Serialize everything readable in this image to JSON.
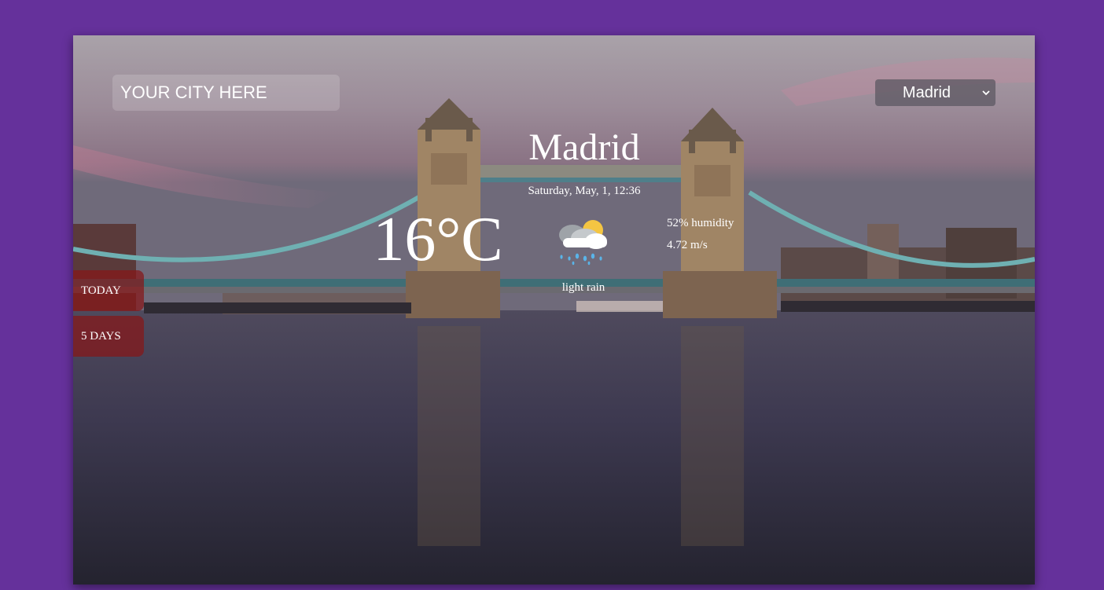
{
  "search": {
    "placeholder": "YOUR CITY HERE"
  },
  "city_select": {
    "selected": "Madrid",
    "icon": "chevron-down-icon"
  },
  "nav": {
    "today_label": "TODAY",
    "five_days_label": "5 DAYS"
  },
  "weather": {
    "city": "Madrid",
    "date": "Saturday, May, 1, 12:36",
    "temperature": "16°C",
    "description": "light rain",
    "humidity": "52% humidity",
    "wind": "4.72 m/s",
    "icon": "rain-cloud-sun-icon"
  },
  "colors": {
    "page_background": "#65319b",
    "nav_button": "#861618",
    "text": "#ffffff"
  }
}
